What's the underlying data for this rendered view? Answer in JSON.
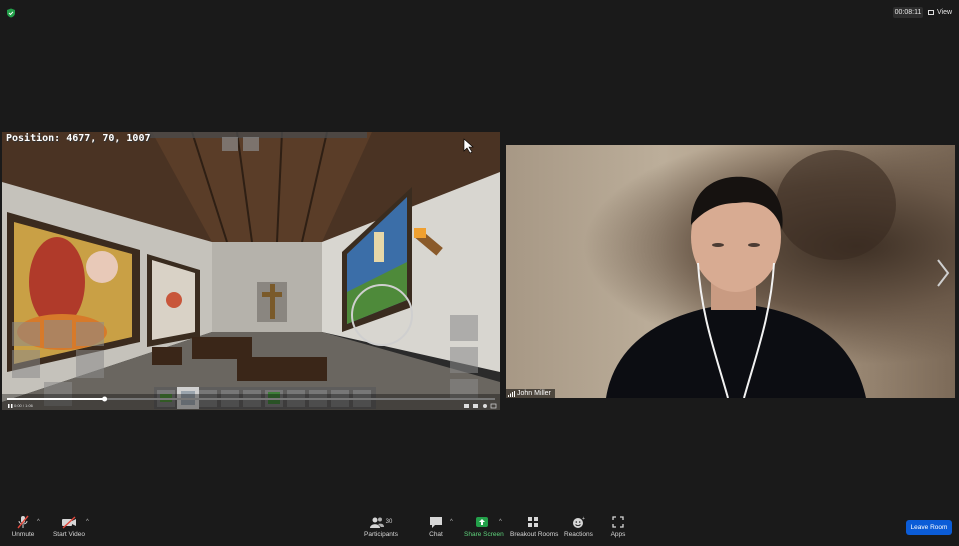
{
  "meeting": {
    "timer": "00:08:11",
    "view_label": "View"
  },
  "share": {
    "position_text": "Position: 4677, 70, 1007",
    "playback_time": "0:00 / 1:06",
    "progress": 0.2
  },
  "participant": {
    "name": "John Miller"
  },
  "toolbar": {
    "unmute": "Unmute",
    "start_video": "Start Video",
    "participants": "Participants",
    "participants_count": "30",
    "chat": "Chat",
    "share_screen": "Share Screen",
    "breakout_rooms": "Breakout Rooms",
    "reactions": "Reactions",
    "apps": "Apps",
    "leave_room": "Leave Room"
  },
  "colors": {
    "accent_blue": "#0b5cd7",
    "share_green": "#23a04a",
    "muted_red": "#e0463a"
  }
}
